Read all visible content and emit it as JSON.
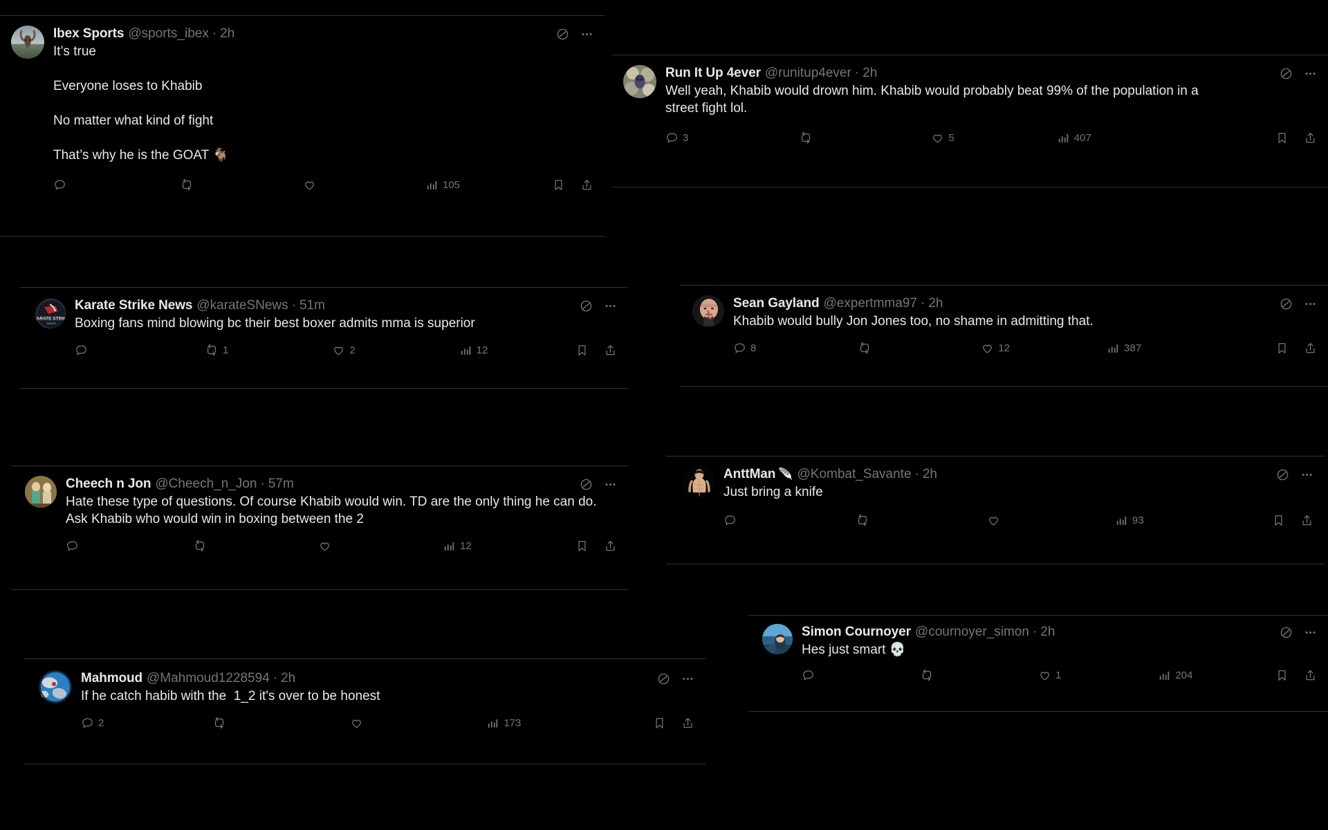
{
  "app": {
    "name": "X (Twitter) replies feed",
    "theme": "dark"
  },
  "icons": {
    "grok": "grok-slashed-circle-icon",
    "more": "more-horizontal-icon",
    "reply": "reply-bubble-icon",
    "repost": "repost-arrows-icon",
    "like": "heart-icon",
    "views": "views-bars-icon",
    "bookmark": "bookmark-icon",
    "share": "share-upload-icon"
  },
  "colors": {
    "background": "#000000",
    "border": "#2f3336",
    "text_primary": "#e7e9ea",
    "text_muted": "#71767b"
  },
  "tweets": [
    {
      "id": "ibex-sports",
      "display_name": "Ibex Sports",
      "handle": "@sports_ibex",
      "separator": "·",
      "timestamp": "2h",
      "text": "It’s true\n\nEveryone loses to Khabib\n\nNo matter what kind of fight\n\nThat’s why he is the GOAT 🐐",
      "reply_count": "",
      "repost_count": "",
      "like_count": "",
      "view_count": "105"
    },
    {
      "id": "run-it-up-4ever",
      "display_name": "Run It Up 4ever",
      "handle": "@runitup4ever",
      "separator": "·",
      "timestamp": "2h",
      "text": "Well yeah, Khabib would drown him. Khabib would probably beat 99% of the population in a street fight lol.",
      "reply_count": "3",
      "repost_count": "",
      "like_count": "5",
      "view_count": "407"
    },
    {
      "id": "karate-strike-news",
      "display_name": "Karate Strike News",
      "handle": "@karateSNews",
      "separator": "·",
      "timestamp": "51m",
      "text": "Boxing fans mind blowing bc their best boxer admits mma is superior",
      "reply_count": "",
      "repost_count": "1",
      "like_count": "2",
      "view_count": "12"
    },
    {
      "id": "sean-gayland",
      "display_name": "Sean Gayland",
      "handle": "@expertmma97",
      "separator": "·",
      "timestamp": "2h",
      "text": "Khabib would bully Jon Jones too, no shame in admitting that.",
      "reply_count": "8",
      "repost_count": "",
      "like_count": "12",
      "view_count": "387"
    },
    {
      "id": "cheech-n-jon",
      "display_name": "Cheech n Jon",
      "handle": "@Cheech_n_Jon",
      "separator": "·",
      "timestamp": "57m",
      "text": "Hate these type of questions. Of course Khabib would win. TD are the only thing he can do. Ask Khabib who would win in boxing between the 2",
      "reply_count": "",
      "repost_count": "",
      "like_count": "",
      "view_count": "12"
    },
    {
      "id": "anttman",
      "display_name": "AnttMan",
      "name_emoji": "🪶",
      "handle": "@Kombat_Savante",
      "separator": "·",
      "timestamp": "2h",
      "text": "Just bring a knife",
      "reply_count": "",
      "repost_count": "",
      "like_count": "",
      "view_count": "93"
    },
    {
      "id": "simon-cournoyer",
      "display_name": "Simon Cournoyer",
      "handle": "@cournoyer_simon",
      "separator": "·",
      "timestamp": "2h",
      "text": "Hes just smart 💀",
      "reply_count": "",
      "repost_count": "",
      "like_count": "1",
      "view_count": "204"
    },
    {
      "id": "mahmoud",
      "display_name": "Mahmoud",
      "handle": "@Mahmoud1228594",
      "separator": "·",
      "timestamp": "2h",
      "text": "If he catch habib with the  1_2 it's over to be honest",
      "reply_count": "2",
      "repost_count": "",
      "like_count": "",
      "view_count": "173"
    }
  ]
}
